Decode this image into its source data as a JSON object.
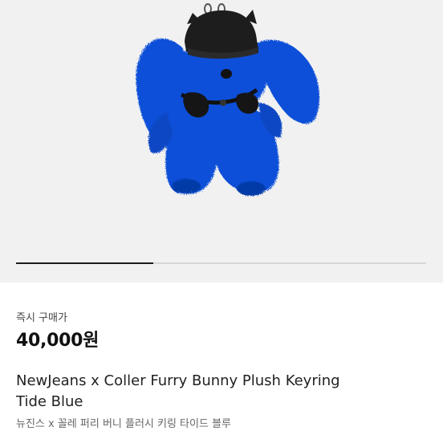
{
  "product": {
    "image_alt": "NewJeans x Coller Furry Bunny Plush Keyring Tide Blue",
    "carousel_progress": 0.335,
    "price_label": "즉시 구매가",
    "price": "40,000원",
    "title_en_line1": "NewJeans x Coller Furry Bunny Plush Keyring",
    "title_en_line2": "Tide Blue",
    "title_ko": "뉴진스 x 꼴레 퍼리 버니 플러시 키링 타이드 블루"
  },
  "colors": {
    "plush_blue": "#0b4fd8",
    "plush_dark_blue": "#063aa8",
    "beanie": "#1d1d1d",
    "hero_bg": "#f1f1f1"
  }
}
